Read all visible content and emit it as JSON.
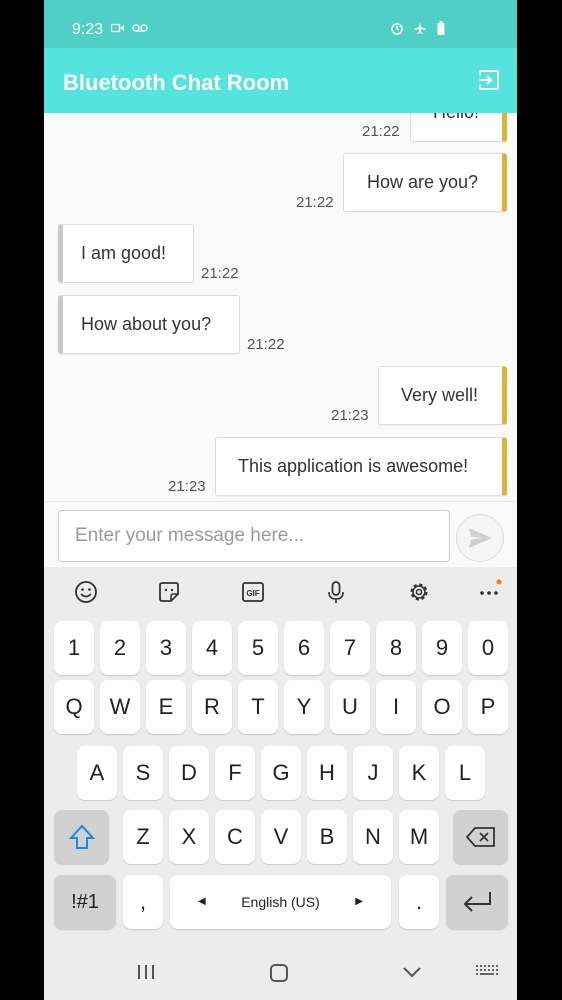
{
  "status": {
    "time": "9:23"
  },
  "app": {
    "title": "Bluetooth Chat Room"
  },
  "messages": [
    {
      "text": "Hello!",
      "time": "21:22",
      "side": "out"
    },
    {
      "text": "How are you?",
      "time": "21:22",
      "side": "out"
    },
    {
      "text": "I am good!",
      "time": "21:22",
      "side": "in"
    },
    {
      "text": "How about you?",
      "time": "21:22",
      "side": "in"
    },
    {
      "text": "Very well!",
      "time": "21:23",
      "side": "out"
    },
    {
      "text": "This application is awesome!",
      "time": "21:23",
      "side": "out"
    }
  ],
  "composer": {
    "placeholder": "Enter your message here..."
  },
  "keyboard": {
    "numbers": [
      "1",
      "2",
      "3",
      "4",
      "5",
      "6",
      "7",
      "8",
      "9",
      "0"
    ],
    "row1": [
      "Q",
      "W",
      "E",
      "R",
      "T",
      "Y",
      "U",
      "I",
      "O",
      "P"
    ],
    "row2": [
      "A",
      "S",
      "D",
      "F",
      "G",
      "H",
      "J",
      "K",
      "L"
    ],
    "row3": [
      "Z",
      "X",
      "C",
      "V",
      "B",
      "N",
      "M"
    ],
    "symbols": "!#1",
    "comma": ",",
    "space": "English (US)",
    "period": "."
  },
  "colors": {
    "statusbar": "#4fcfc6",
    "appbar": "#55e3dd",
    "outgoing_accent": "#d7b43a",
    "incoming_accent": "#c9c9c9"
  },
  "icons": [
    "video-call-icon",
    "voicemail-icon",
    "alarm-icon",
    "airplane-mode-icon",
    "battery-icon",
    "exit-icon",
    "send-icon",
    "emoji-icon",
    "sticker-icon",
    "gif-icon",
    "mic-icon",
    "settings-icon",
    "more-icon",
    "shift-icon",
    "backspace-icon",
    "enter-icon",
    "recents-icon",
    "home-icon",
    "back-icon",
    "keyboard-icon"
  ]
}
